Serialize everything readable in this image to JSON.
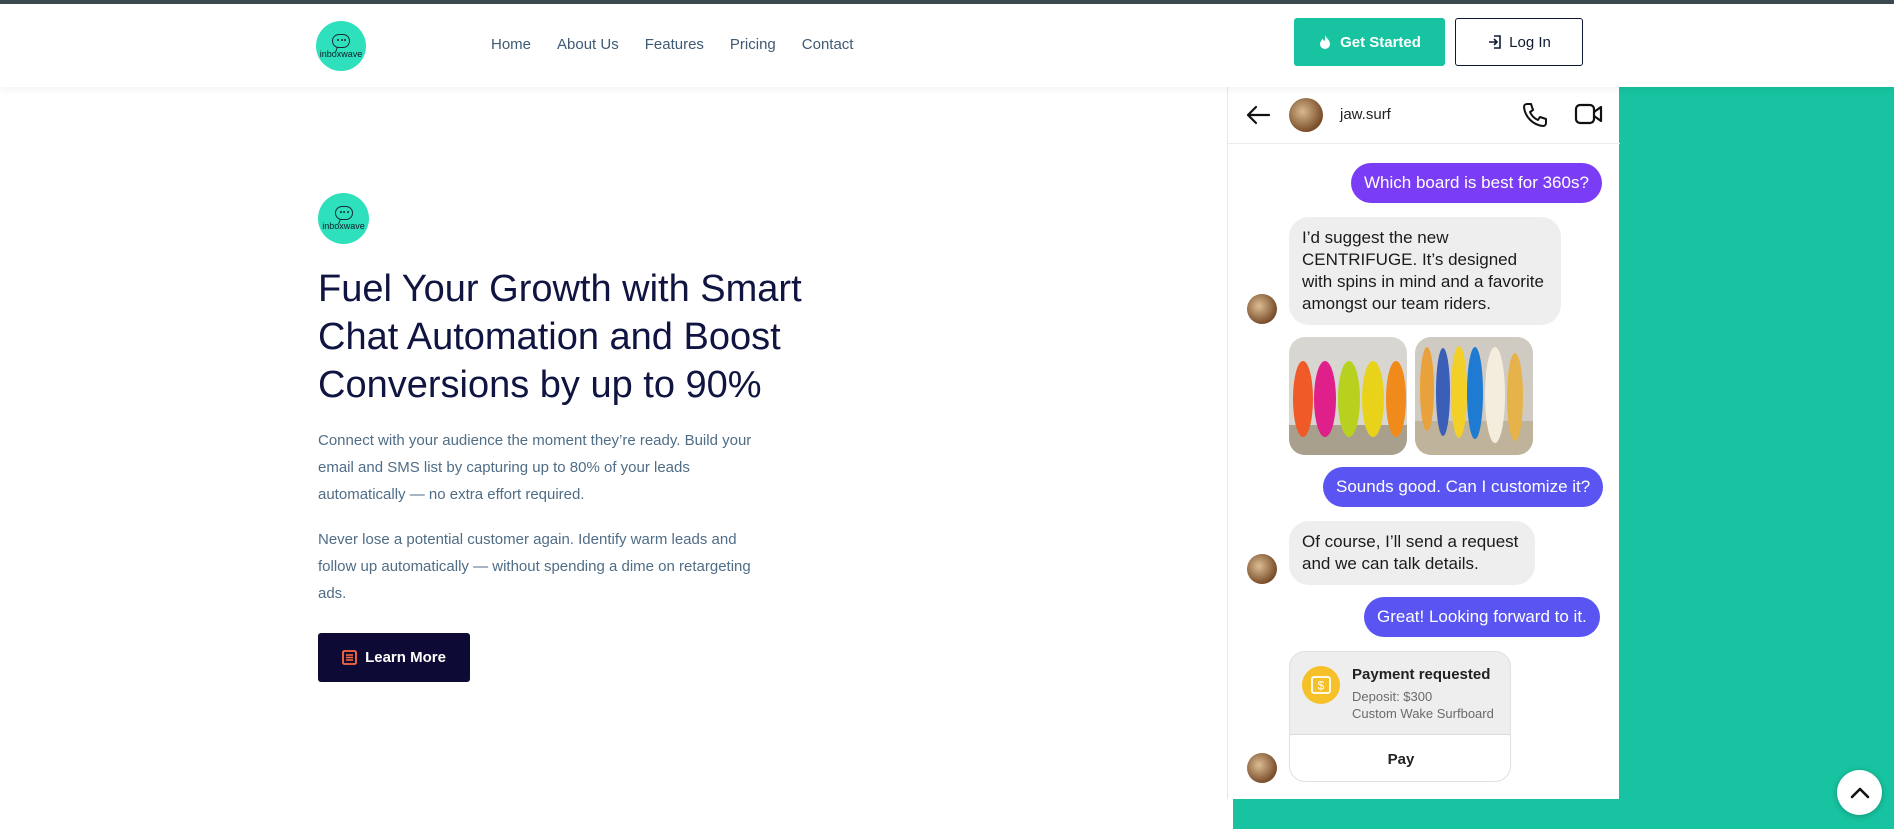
{
  "header": {
    "logo_text": "inboxwave",
    "nav": [
      "Home",
      "About Us",
      "Features",
      "Pricing",
      "Contact"
    ],
    "get_started": "Get Started",
    "login": "Log In"
  },
  "hero": {
    "logo_text": "inboxwave",
    "title": "Fuel Your Growth with Smart Chat Automation and Boost Conversions by up to 90%",
    "p1": "Connect with your audience the moment they’re ready. Build your email and SMS list by capturing up to 80% of your leads automatically — no extra effort required.",
    "p2": "Never lose a potential customer again. Identify warm leads and follow up automatically — without spending a dime on retargeting ads.",
    "learn_more": "Learn More"
  },
  "chat": {
    "username": "jaw.surf",
    "messages": [
      "Which board is best for 360s?",
      "I’d suggest the new CENTRIFUGE. It’s designed with spins in mind and a favorite amongst our team riders.",
      "Sounds good. Can I customize it?",
      "Of course, I’ll send a request and we can talk details.",
      "Great! Looking forward to it."
    ],
    "payment": {
      "title": "Payment requested",
      "deposit": "Deposit: $300",
      "item": "Custom Wake Surfboard",
      "pay": "Pay"
    }
  },
  "colors": {
    "accent_green": "#17c3a0",
    "navy": "#0d0b35",
    "bubble_purple": "#7b3cf5",
    "bubble_indigo": "#5a55f2"
  }
}
